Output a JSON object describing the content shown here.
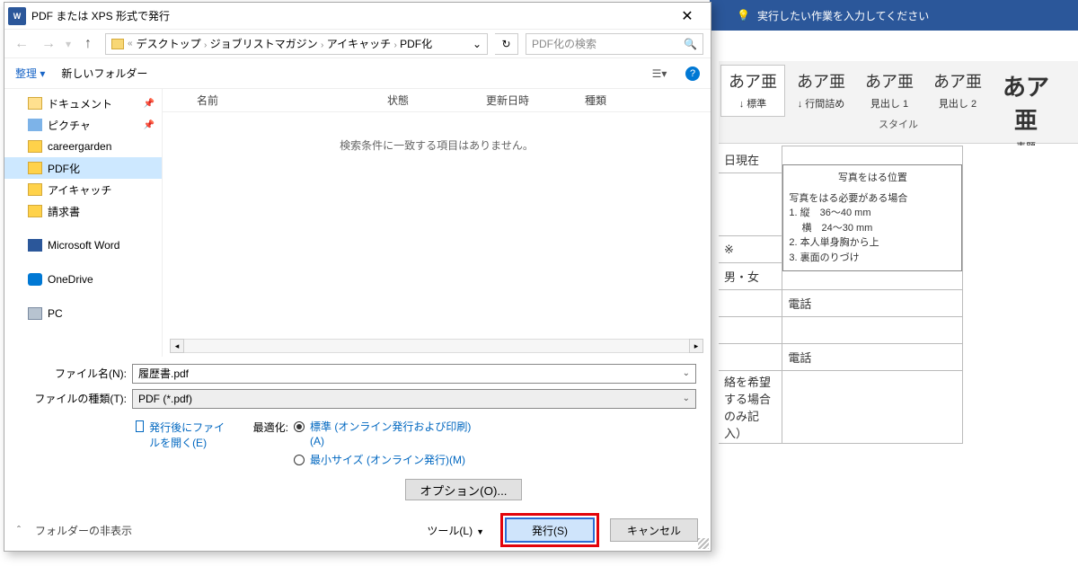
{
  "word": {
    "tell_me": "実行したい作業を入力してください",
    "styles": [
      {
        "sample": "あア亜",
        "name": "↓ 標準"
      },
      {
        "sample": "あア亜",
        "name": "↓ 行間詰め"
      },
      {
        "sample": "あア亜",
        "name": "見出し 1"
      },
      {
        "sample": "あア亜",
        "name": "見出し 2"
      },
      {
        "sample": "あア亜",
        "name": "表題"
      }
    ],
    "styles_group": "スタイル",
    "doc": {
      "date_suffix": "日現在",
      "photo_title": "写真をはる位置",
      "photo_body1": "写真をはる必要がある場合",
      "photo_l1": "1. 縦　36〜40 mm",
      "photo_l2": "　 横　24〜30 mm",
      "photo_l3": "2. 本人単身胸から上",
      "photo_l4": "3. 裏面のりづけ",
      "asterisk": "※",
      "gender": "男・女",
      "tel": "電話",
      "note": "絡を希望する場合のみ記入）"
    }
  },
  "dialog": {
    "title": "PDF または XPS 形式で発行",
    "breadcrumb": [
      "デスクトップ",
      "ジョブリストマガジン",
      "アイキャッチ",
      "PDF化"
    ],
    "search_placeholder": "PDF化の検索",
    "organize": "整理 ▾",
    "new_folder": "新しいフォルダー",
    "tree": [
      {
        "label": "ドキュメント",
        "icon": "folder",
        "pinned": true
      },
      {
        "label": "ピクチャ",
        "icon": "img",
        "pinned": true
      },
      {
        "label": "careergarden",
        "icon": "folder-y"
      },
      {
        "label": "PDF化",
        "icon": "folder-y",
        "selected": true
      },
      {
        "label": "アイキャッチ",
        "icon": "folder-y"
      },
      {
        "label": "請求書",
        "icon": "folder-y"
      },
      {
        "label": "Microsoft Word",
        "icon": "wordapp",
        "gap": true
      },
      {
        "label": "OneDrive",
        "icon": "onedrive",
        "gap": true
      },
      {
        "label": "PC",
        "icon": "pc",
        "gap": true
      }
    ],
    "columns": {
      "name": "名前",
      "status": "状態",
      "date": "更新日時",
      "type": "種類"
    },
    "empty": "検索条件に一致する項目はありません。",
    "filename_label": "ファイル名(N):",
    "filename_value": "履歴書.pdf",
    "filetype_label": "ファイルの種類(T):",
    "filetype_value": "PDF (*.pdf)",
    "open_after": "発行後にファイルを開く(E)",
    "optimize_label": "最適化:",
    "opt_standard": "標準 (オンライン発行および印刷)(A)",
    "opt_min": "最小サイズ (オンライン発行)(M)",
    "options_btn": "オプション(O)...",
    "tools": "ツール(L)",
    "publish": "発行(S)",
    "cancel": "キャンセル",
    "hide_folders": "フォルダーの非表示"
  }
}
